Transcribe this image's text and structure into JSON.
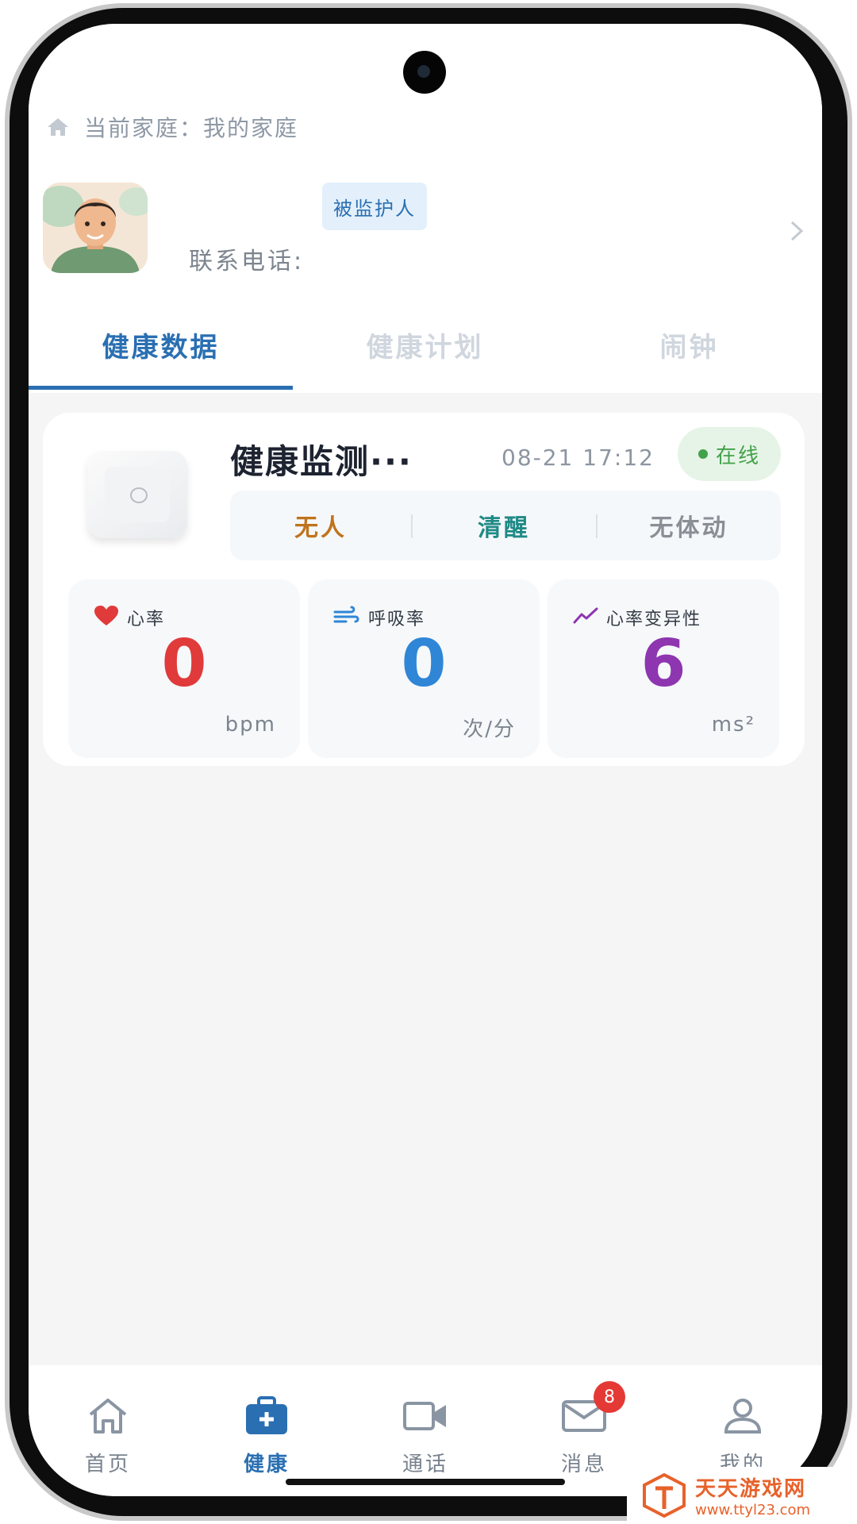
{
  "header": {
    "family_label": "当前家庭：我的家庭"
  },
  "profile": {
    "role_badge": "被监护人",
    "phone_label": "联系电话:"
  },
  "tabs": [
    {
      "label": "健康数据",
      "active": true
    },
    {
      "label": "健康计划",
      "active": false
    },
    {
      "label": "闹钟",
      "active": false
    }
  ],
  "device": {
    "name": "健康监测···",
    "time": "08-21 17:12",
    "status": "在线",
    "states": [
      {
        "label": "无人",
        "color": "#c0731d"
      },
      {
        "label": "清醒",
        "color": "#1f8a86"
      },
      {
        "label": "无体动",
        "color": "#8a8f96"
      }
    ]
  },
  "metrics": [
    {
      "label": "心率",
      "value": "0",
      "unit": "bpm",
      "color": "#e03a3a",
      "icon": "heart-icon"
    },
    {
      "label": "呼吸率",
      "value": "0",
      "unit": "次/分",
      "color": "#2f86d6",
      "icon": "wind-icon"
    },
    {
      "label": "心率变异性",
      "value": "6",
      "unit": "ms²",
      "color": "#8e35b0",
      "icon": "trend-icon"
    }
  ],
  "nav": [
    {
      "label": "首页",
      "icon": "home-icon",
      "active": false
    },
    {
      "label": "健康",
      "icon": "medical-kit-icon",
      "active": true
    },
    {
      "label": "通话",
      "icon": "video-call-icon",
      "active": false
    },
    {
      "label": "消息",
      "icon": "mail-icon",
      "active": false,
      "badge": "8"
    },
    {
      "label": "我的",
      "icon": "person-icon",
      "active": false
    }
  ],
  "watermark": {
    "title": "天天游戏网",
    "url": "www.ttyl23.com"
  }
}
